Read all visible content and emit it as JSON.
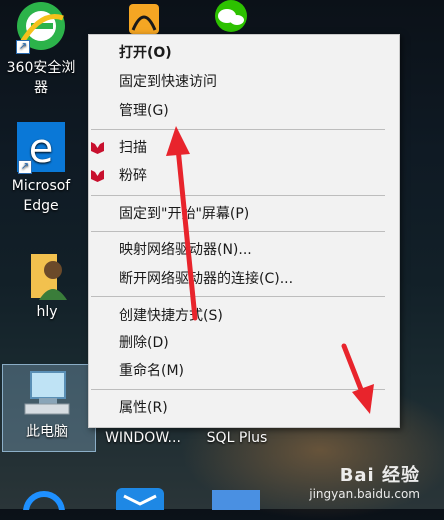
{
  "desktop": {
    "icons": [
      {
        "name": "360安全浏览器",
        "line1": "360安全浏",
        "line2": "器"
      },
      {
        "name": "Microsoft Edge",
        "line1": "Microsof",
        "line2": "Edge"
      },
      {
        "name": "hly",
        "line1": "hly"
      },
      {
        "name": "此电脑",
        "line1": "此电脑"
      },
      {
        "name": "WINDOW...",
        "line1": "WINDOW..."
      },
      {
        "name": "SQL Plus",
        "line1": "SQL Plus"
      }
    ]
  },
  "context_menu": {
    "items": [
      {
        "label": "打开(O)",
        "bold": true
      },
      {
        "label": "固定到快速访问"
      },
      {
        "label": "管理(G)"
      },
      {
        "label": "扫描",
        "icon": "mcafee-icon"
      },
      {
        "label": "粉碎",
        "icon": "mcafee-icon"
      },
      {
        "label": "固定到\"开始\"屏幕(P)"
      },
      {
        "label": "映射网络驱动器(N)..."
      },
      {
        "label": "断开网络驱动器的连接(C)..."
      },
      {
        "label": "创建快捷方式(S)"
      },
      {
        "label": "删除(D)"
      },
      {
        "label": "重命名(M)"
      },
      {
        "label": "属性(R)"
      }
    ]
  },
  "watermark": {
    "brand": "Bai 经验",
    "url": "jingyan.baidu.com"
  },
  "colors": {
    "menu_bg": "#f2f2f2",
    "arrow": "#e8242c",
    "mcafee": "#c8102e",
    "selection": "#8cb4d2"
  }
}
